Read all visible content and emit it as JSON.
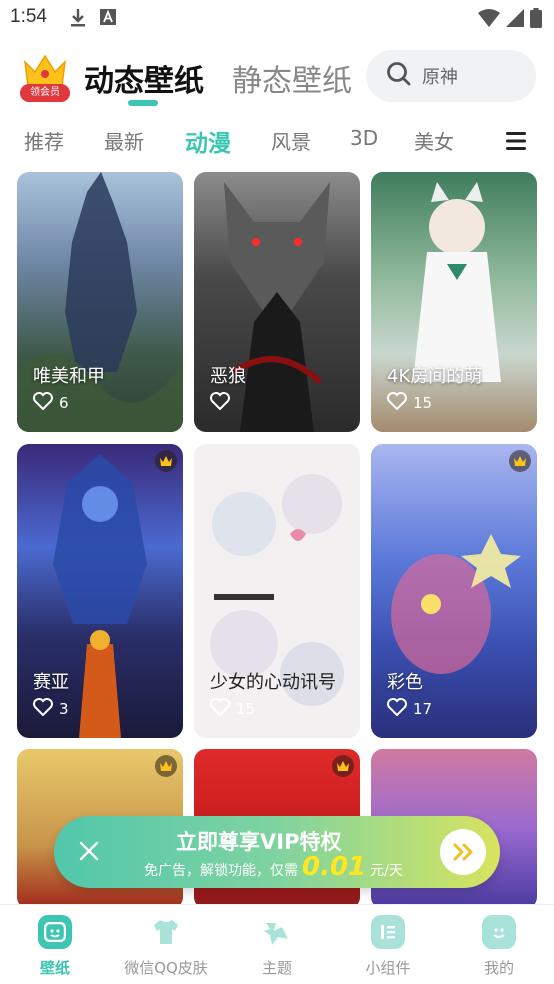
{
  "status": {
    "time": "1:54"
  },
  "header": {
    "vip_label": "领会员",
    "tab_active": "动态壁纸",
    "tab_inactive": "静态壁纸",
    "search_placeholder": "原神"
  },
  "categories": [
    "推荐",
    "最新",
    "动漫",
    "风景",
    "3D",
    "美女"
  ],
  "active_category": "动漫",
  "cards": [
    {
      "title": "唯美和甲",
      "likes": "6",
      "vip": false
    },
    {
      "title": "恶狼",
      "likes": "",
      "vip": false
    },
    {
      "title": "4K房间的萌",
      "likes": "15",
      "vip": false
    },
    {
      "title": "赛亚",
      "likes": "3",
      "vip": true
    },
    {
      "title": "少女的心动讯号",
      "likes": "15",
      "vip": false
    },
    {
      "title": "彩色",
      "likes": "17",
      "vip": true
    },
    {
      "title": "",
      "likes": "",
      "vip": true
    },
    {
      "title": "",
      "likes": "",
      "vip": true
    },
    {
      "title": "",
      "likes": "",
      "vip": false
    }
  ],
  "promo": {
    "title": "立即尊享VIP特权",
    "sub_prefix": "免广告，解锁功能，仅需",
    "price": "0.01",
    "unit": "元/天"
  },
  "nav": [
    {
      "label": "壁纸",
      "active": true,
      "icon": "wallpaper-icon"
    },
    {
      "label": "微信QQ皮肤",
      "active": false,
      "icon": "tshirt-icon"
    },
    {
      "label": "主题",
      "active": false,
      "icon": "theme-icon"
    },
    {
      "label": "小组件",
      "active": false,
      "icon": "widget-icon"
    },
    {
      "label": "我的",
      "active": false,
      "icon": "profile-icon"
    }
  ],
  "colors": {
    "accent": "#3cc5b2",
    "vip_red": "#e0393b",
    "price_yellow": "#ffe81e"
  }
}
